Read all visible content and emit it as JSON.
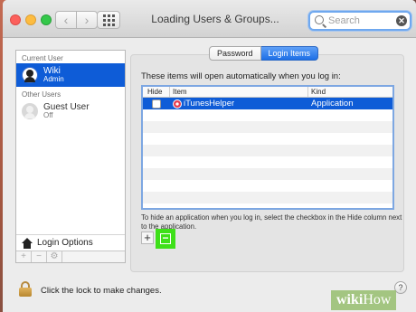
{
  "window": {
    "title": "Loading Users & Groups...",
    "search_placeholder": "Search",
    "search_clear_glyph": "✕",
    "nav_back_glyph": "‹",
    "nav_forward_glyph": "›"
  },
  "sidebar": {
    "current_user_header": "Current User",
    "current_user": {
      "name": "Wiki",
      "role": "Admin"
    },
    "other_users_header": "Other Users",
    "other_users": [
      {
        "name": "Guest User",
        "role": "Off"
      }
    ],
    "login_options_label": "Login Options",
    "tools": {
      "add": "+",
      "remove": "−",
      "settings": "⚙"
    }
  },
  "tabs": [
    {
      "label": "Password",
      "active": false
    },
    {
      "label": "Login Items",
      "active": true
    }
  ],
  "login_items": {
    "heading": "These items will open automatically when you log in:",
    "columns": {
      "hide": "Hide",
      "item": "Item",
      "kind": "Kind"
    },
    "rows": [
      {
        "hide": false,
        "item": "iTunesHelper",
        "kind": "Application",
        "selected": true
      }
    ],
    "hint": "To hide an application when you log in, select the checkbox in the Hide column next to the application.",
    "add_label": "+",
    "remove_label": "−"
  },
  "footer": {
    "lock_text": "Click the lock to make changes.",
    "help_label": "?"
  },
  "watermark": {
    "part1": "wiki",
    "part2": "How"
  },
  "colors": {
    "selection": "#0e5cd7",
    "highlight_green": "#3ee019",
    "tab_active": "#1d6fe6"
  }
}
